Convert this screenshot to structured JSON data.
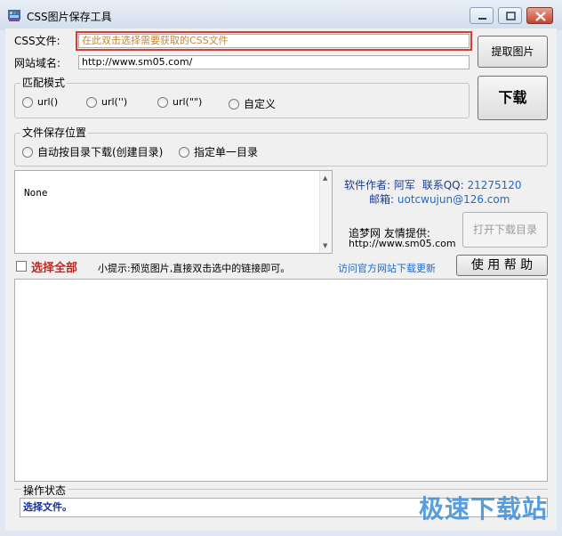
{
  "window": {
    "title": "CSS图片保存工具",
    "icon": "app-icon",
    "controls": [
      "minimize-icon",
      "maximize-icon",
      "close-icon"
    ]
  },
  "css_file": {
    "label": "CSS文件:",
    "placeholder": "在此双击选择需要获取的CSS文件",
    "value": ""
  },
  "domain": {
    "label": "网站域名:",
    "value": "http://www.sm05.com/"
  },
  "buttons": {
    "extract": "提取图片",
    "download": "下载",
    "open_dir": "打开下载目录",
    "help": "使 用 帮 助"
  },
  "match_mode": {
    "legend": "匹配模式",
    "options": [
      "url()",
      "url('')",
      "url(\"\")",
      "自定义"
    ],
    "selected": null
  },
  "save_location": {
    "legend": "文件保存位置",
    "options": [
      "自动按目录下载(创建目录)",
      "指定单一目录"
    ],
    "selected": null
  },
  "list": {
    "text": "None"
  },
  "author": {
    "label": "软件作者:",
    "name": "阿军",
    "qq_label": "联系QQ:",
    "qq": "21275120",
    "email_label": "邮箱:",
    "email": "uotcwujun@126.com"
  },
  "provider": {
    "text": "追梦网 友情提供:",
    "url": "http://www.sm05.com"
  },
  "select_all": {
    "label": "选择全部",
    "checked": false
  },
  "tip": "小提示:预览图片,直接双击选中的链接即可。",
  "update_link": "访问官方网站下载更新",
  "status": {
    "legend": "操作状态",
    "text": "选择文件。"
  },
  "watermark": "极速下载站",
  "colors": {
    "highlight_border": "#d63d35",
    "select_all": "#c0261e",
    "author_text": "#1e3c8c",
    "link": "#1e6ac8",
    "status_text": "#1a2e9c",
    "watermark": "#3c8ed8"
  }
}
